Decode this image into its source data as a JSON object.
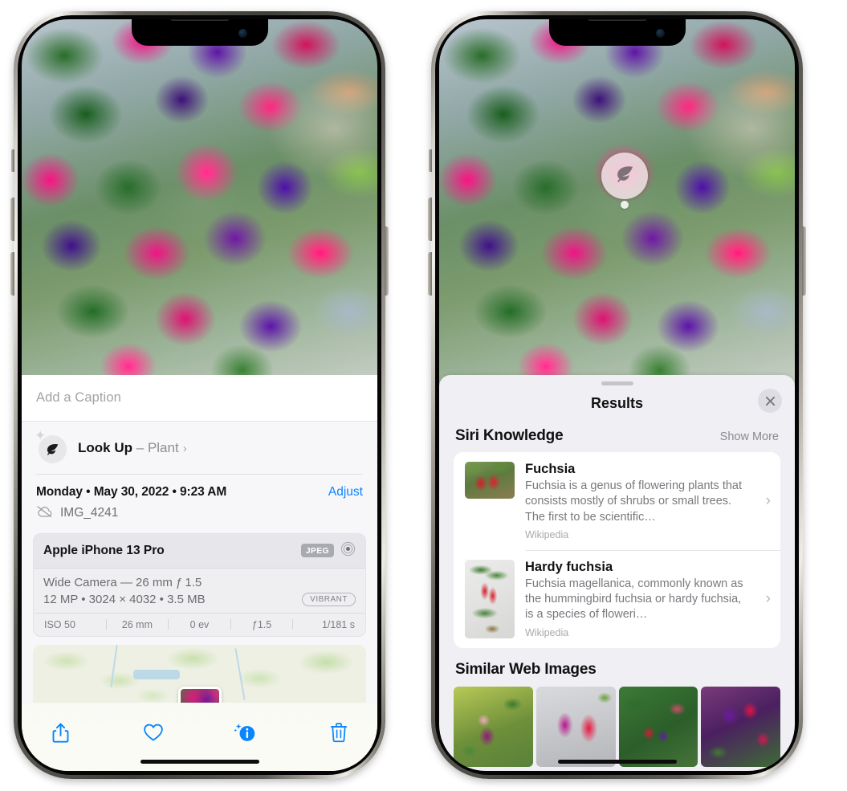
{
  "left_phone": {
    "caption": {
      "placeholder": "Add a Caption",
      "value": ""
    },
    "look_up": {
      "icon": "leaf-icon",
      "label": "Look Up",
      "dash": "–",
      "subject": "Plant",
      "chevron": "›"
    },
    "metadata": {
      "date_line": "Monday • May 30, 2022 • 9:23 AM",
      "adjust_label": "Adjust",
      "cloud_icon": "cloud-slash-icon",
      "filename": "IMG_4241"
    },
    "camera_card": {
      "device": "Apple iPhone 13 Pro",
      "format_badge": "JPEG",
      "lens_icon": "depth-circles-icon",
      "lens_line": "Wide Camera — 26 mm ƒ 1.5",
      "size_line": "12 MP • 3024 × 4032 • 3.5 MB",
      "style_chip": "VIBRANT",
      "exif": [
        "ISO 50",
        "26 mm",
        "0 ev",
        "ƒ1.5",
        "1/181 s"
      ]
    },
    "map": {
      "pin": "photo-thumbnail-pin"
    },
    "toolbar": [
      {
        "name": "share-button",
        "icon": "share-icon"
      },
      {
        "name": "favorite-button",
        "icon": "heart-icon"
      },
      {
        "name": "info-button",
        "icon": "info-sparkle-icon"
      },
      {
        "name": "delete-button",
        "icon": "trash-icon"
      }
    ]
  },
  "right_phone": {
    "badge": {
      "icon": "leaf-icon",
      "name": "visual-look-up-badge"
    },
    "sheet": {
      "title": "Results",
      "close_icon": "close-icon",
      "siri_knowledge": {
        "heading": "Siri Knowledge",
        "show_more": "Show More",
        "items": [
          {
            "title": "Fuchsia",
            "description": "Fuchsia is a genus of flowering plants that consists mostly of shrubs or small trees. The first to be scientific…",
            "source": "Wikipedia",
            "chevron": "›"
          },
          {
            "title": "Hardy fuchsia",
            "description": "Fuchsia magellanica, commonly known as the hummingbird fuchsia or hardy fuchsia, is a species of floweri…",
            "source": "Wikipedia",
            "chevron": "›"
          }
        ]
      },
      "similar_web_images": {
        "heading": "Similar Web Images",
        "count": 4
      }
    }
  },
  "colors": {
    "accent_blue": "#0a84ff",
    "sheet_bg": "#f0eff4",
    "panel_bg": "#f7f7f9",
    "card_bg": "#ffffff",
    "secondary_text": "#79797f"
  }
}
